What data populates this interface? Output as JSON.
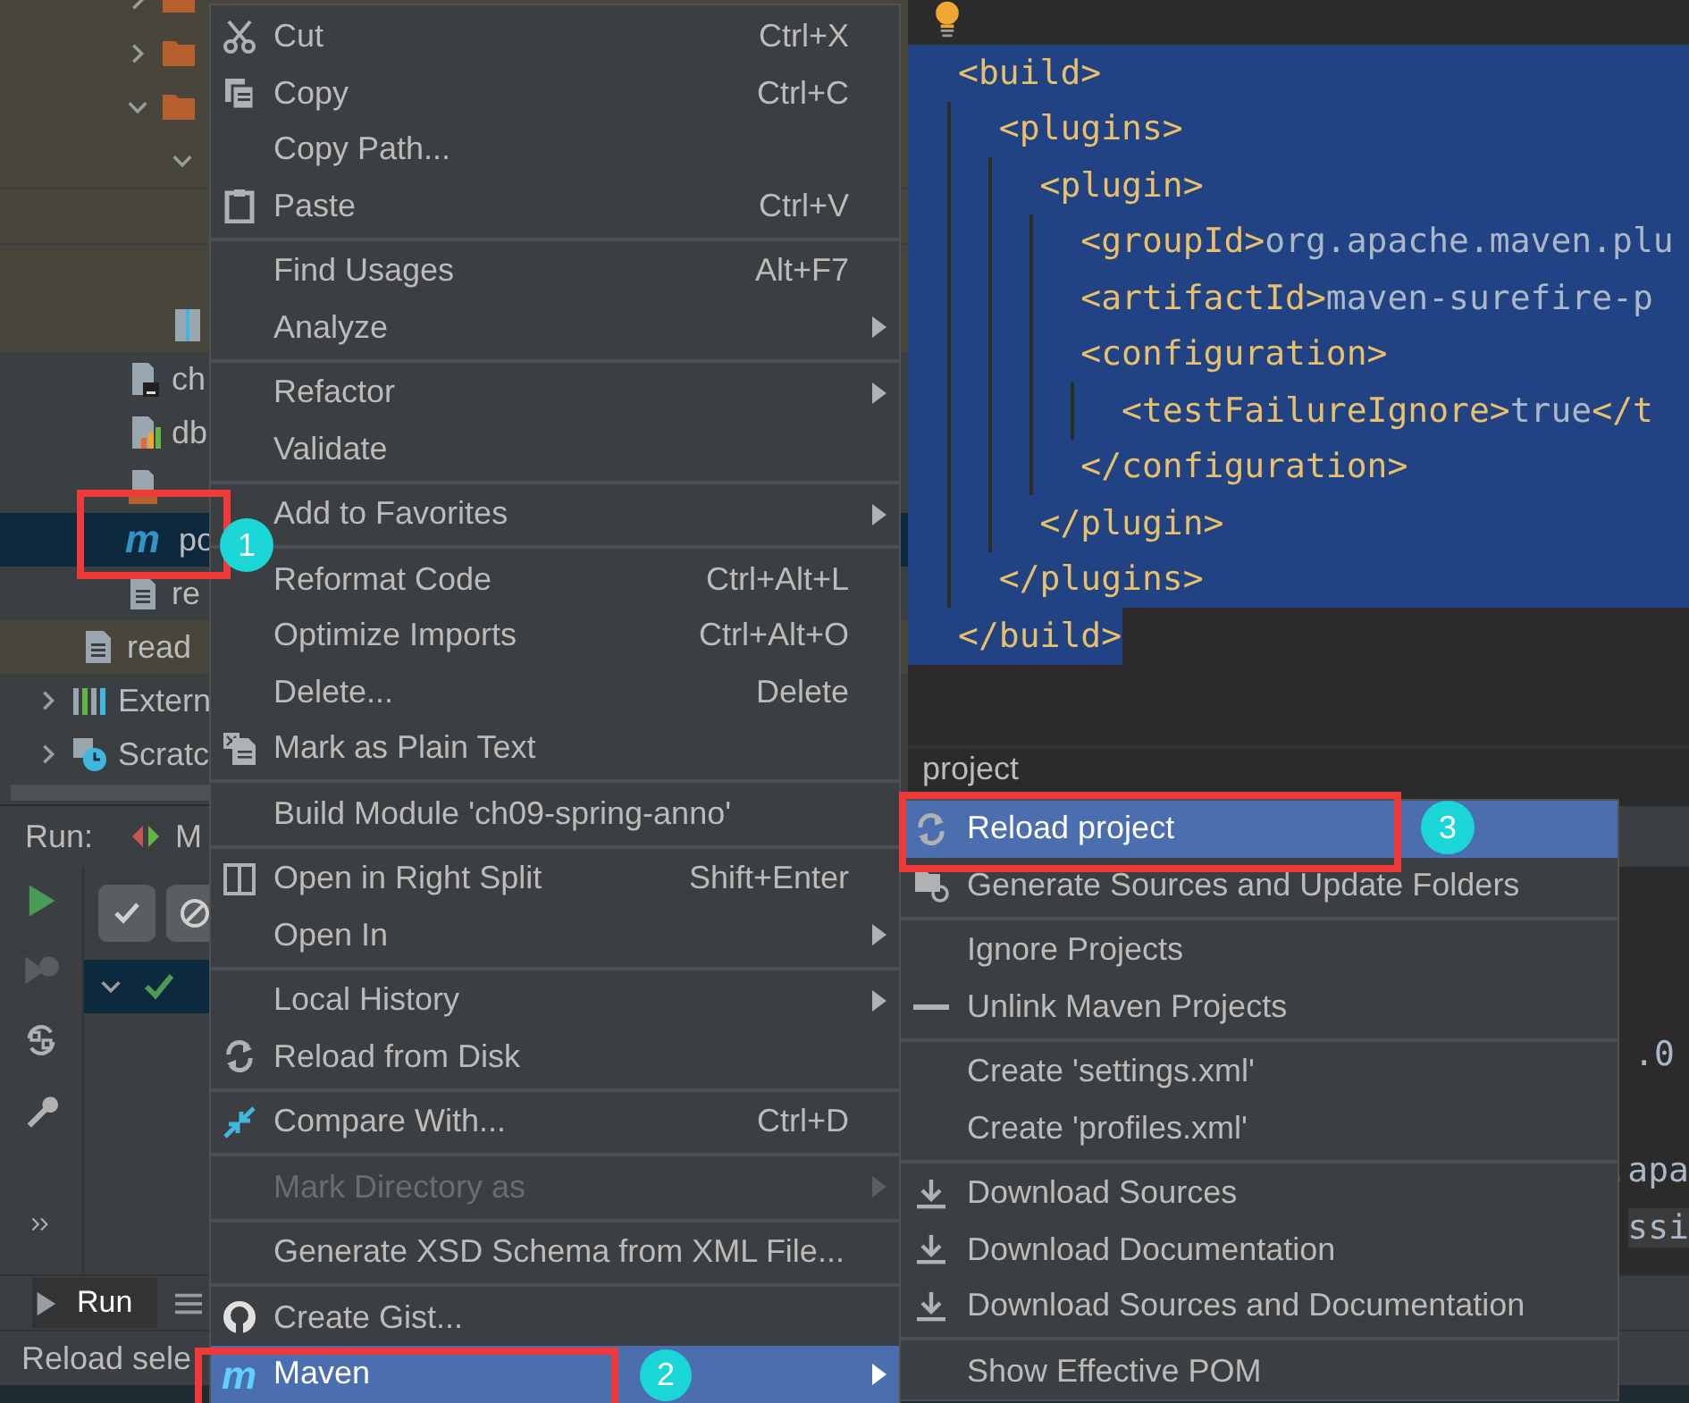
{
  "project_tree": [
    {
      "children": [
        {
          "children": [
            {
              "kind": "folder",
              "expanded": false,
              "excluded": true,
              "selected": false
            },
            {
              "kind": "folder",
              "expanded": false,
              "excluded": true,
              "selected": false
            },
            {
              "kind": "folder",
              "expanded": true,
              "excluded": true,
              "selected": false,
              "children": [
                {
                  "expanded": true,
                  "excluded": true,
                  "selected": false
                },
                {
                  "kind": "archive",
                  "excluded": true,
                  "selected": false
                }
              ]
            },
            {
              "label": "ch",
              "kind": "terminal-file",
              "excluded": false,
              "selected": false
            },
            {
              "label": "db",
              "kind": "chart-file",
              "excluded": false,
              "selected": false
            },
            {
              "kind": "image-file",
              "excluded": false,
              "selected": false
            },
            {
              "label": "po",
              "icon_text": "m",
              "excluded": false,
              "selected": true
            },
            {
              "label": "re",
              "kind": "text-file",
              "excluded": false,
              "selected": false
            }
          ]
        },
        {
          "label": "read",
          "kind": "text-file",
          "excluded": true,
          "selected": false
        }
      ]
    },
    {
      "label": "Extern",
      "kind": "library",
      "expanded": false,
      "excluded": false,
      "selected": false
    },
    {
      "label": "Scratc",
      "kind": "scratch",
      "expanded": false,
      "excluded": false,
      "selected": false
    }
  ],
  "editor": {
    "lines": [
      {
        "selected": true,
        "parts": [
          {
            "kind": "tag",
            "text": "<build>"
          }
        ]
      },
      {
        "selected": true,
        "parts": [
          {
            "kind": "tag",
            "text": "  <plugins>"
          }
        ]
      },
      {
        "selected": true,
        "parts": [
          {
            "kind": "tag",
            "text": "    <plugin>"
          }
        ]
      },
      {
        "selected": true,
        "parts": [
          {
            "kind": "tag",
            "text": "      <groupId>"
          },
          {
            "kind": "value",
            "text": "org.apache.maven.plu"
          }
        ]
      },
      {
        "selected": true,
        "parts": [
          {
            "kind": "tag",
            "text": "      <artifactId>"
          },
          {
            "kind": "value",
            "text": "maven-surefire-p"
          }
        ]
      },
      {
        "selected": true,
        "parts": [
          {
            "kind": "tag",
            "text": "      <configuration>"
          }
        ]
      },
      {
        "selected": true,
        "parts": [
          {
            "kind": "tag",
            "text": "        <testFailureIgnore>"
          },
          {
            "kind": "value",
            "text": "true"
          },
          {
            "kind": "tag",
            "text": "</t"
          }
        ]
      },
      {
        "selected": true,
        "parts": [
          {
            "kind": "tag",
            "text": "      </configuration>"
          }
        ]
      },
      {
        "selected": true,
        "parts": [
          {
            "kind": "tag",
            "text": "    </plugin>"
          }
        ]
      },
      {
        "selected": true,
        "parts": [
          {
            "kind": "tag",
            "text": "  </plugins>"
          }
        ]
      },
      {
        "selected": true,
        "parts": [
          {
            "kind": "tag",
            "text": "</build>"
          }
        ]
      }
    ],
    "breadcrumb": "project"
  },
  "run_panel": {
    "title": "Run:",
    "tab_label": "M",
    "tree_rows": [
      {
        "expanded": true
      }
    ],
    "console_lines": [
      ".0",
      ".apa",
      "ssi"
    ]
  },
  "bottom_tabs": [
    {
      "label": "Run",
      "selected": true
    }
  ],
  "status_bar": {
    "text": "Reload sele"
  },
  "context_menu": {
    "groups": [
      [
        {
          "label": "Cut",
          "shortcut": "Ctrl+X",
          "kind": "scissors",
          "submenu": false,
          "disabled": false,
          "selected": false
        },
        {
          "label": "Copy",
          "shortcut": "Ctrl+C",
          "kind": "copy",
          "submenu": false,
          "disabled": false,
          "selected": false
        },
        {
          "label": "Copy Path...",
          "submenu": false,
          "disabled": false,
          "selected": false
        },
        {
          "label": "Paste",
          "shortcut": "Ctrl+V",
          "kind": "clipboard",
          "submenu": false,
          "disabled": false,
          "selected": false
        }
      ],
      [
        {
          "label": "Find Usages",
          "shortcut": "Alt+F7",
          "submenu": false,
          "disabled": false,
          "selected": false
        },
        {
          "label": "Analyze",
          "submenu": true,
          "disabled": false,
          "selected": false
        }
      ],
      [
        {
          "label": "Refactor",
          "submenu": true,
          "disabled": false,
          "selected": false
        },
        {
          "label": "Validate",
          "submenu": false,
          "disabled": false,
          "selected": false
        }
      ],
      [
        {
          "label": "Add to Favorites",
          "submenu": true,
          "disabled": false,
          "selected": false
        }
      ],
      [
        {
          "label": "Reformat Code",
          "shortcut": "Ctrl+Alt+L",
          "submenu": false,
          "disabled": false,
          "selected": false
        },
        {
          "label": "Optimize Imports",
          "shortcut": "Ctrl+Alt+O",
          "submenu": false,
          "disabled": false,
          "selected": false
        },
        {
          "label": "Delete...",
          "shortcut": "Delete",
          "submenu": false,
          "disabled": false,
          "selected": false
        },
        {
          "label": "Mark as Plain Text",
          "kind": "plain-text",
          "submenu": false,
          "disabled": false,
          "selected": false
        }
      ],
      [
        {
          "label": "Build Module 'ch09-spring-anno'",
          "submenu": false,
          "disabled": false,
          "selected": false
        }
      ],
      [
        {
          "label": "Open in Right Split",
          "shortcut": "Shift+Enter",
          "kind": "split",
          "submenu": false,
          "disabled": false,
          "selected": false
        },
        {
          "label": "Open In",
          "submenu": true,
          "disabled": false,
          "selected": false
        }
      ],
      [
        {
          "label": "Local History",
          "submenu": true,
          "disabled": false,
          "selected": false
        },
        {
          "label": "Reload from Disk",
          "kind": "reload",
          "submenu": false,
          "disabled": false,
          "selected": false
        }
      ],
      [
        {
          "label": "Compare With...",
          "shortcut": "Ctrl+D",
          "kind": "compare",
          "submenu": false,
          "disabled": false,
          "selected": false
        }
      ],
      [
        {
          "label": "Mark Directory as",
          "submenu": true,
          "disabled": true,
          "selected": false
        }
      ],
      [
        {
          "label": "Generate XSD Schema from XML File...",
          "submenu": false,
          "disabled": false,
          "selected": false
        }
      ],
      [
        {
          "label": "Create Gist...",
          "kind": "octocat",
          "submenu": false,
          "disabled": false,
          "selected": false
        },
        {
          "label": "Maven",
          "icon_text": "m",
          "submenu": true,
          "disabled": false,
          "selected": true
        }
      ]
    ]
  },
  "submenu": {
    "groups": [
      [
        {
          "label": "Reload project",
          "kind": "reload",
          "selected": true
        },
        {
          "label": "Generate Sources and Update Folders",
          "kind": "folder-reload",
          "selected": false
        }
      ],
      [
        {
          "label": "Ignore Projects",
          "selected": false
        },
        {
          "label": "Unlink Maven Projects",
          "kind": "minus",
          "selected": false
        }
      ],
      [
        {
          "label": "Create 'settings.xml'",
          "selected": false
        },
        {
          "label": "Create 'profiles.xml'",
          "selected": false
        }
      ],
      [
        {
          "label": "Download Sources",
          "kind": "download",
          "selected": false
        },
        {
          "label": "Download Documentation",
          "kind": "download",
          "selected": false
        },
        {
          "label": "Download Sources and Documentation",
          "kind": "download",
          "selected": false
        }
      ],
      [
        {
          "label": "Show Effective POM",
          "selected": false
        }
      ]
    ]
  },
  "callouts": [
    "1",
    "2",
    "3"
  ]
}
